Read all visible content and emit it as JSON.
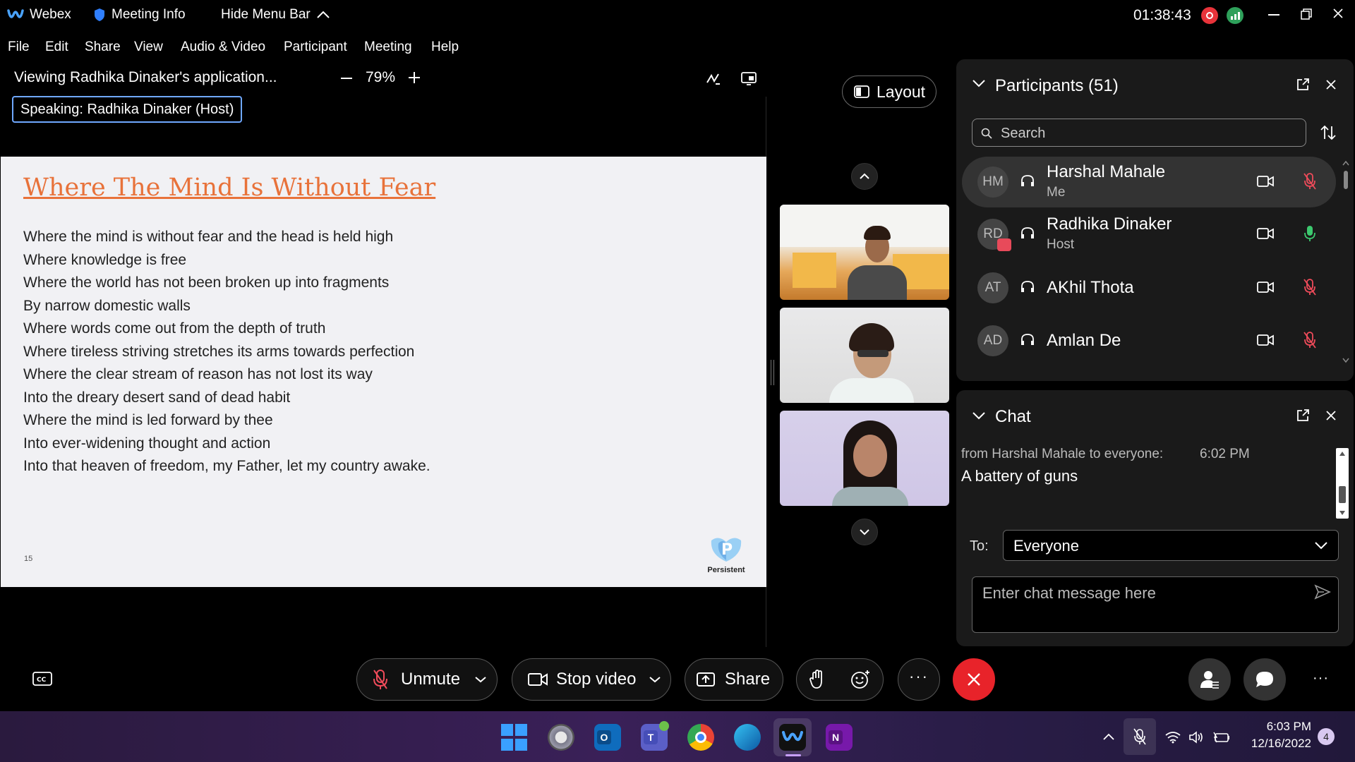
{
  "topbar": {
    "app_name": "Webex",
    "meeting_info": "Meeting Info",
    "hide_menu": "Hide Menu Bar",
    "timer": "01:38:43"
  },
  "menu": [
    "File",
    "Edit",
    "Share",
    "View",
    "Audio & Video",
    "Participant",
    "Meeting",
    "Help"
  ],
  "viewer": {
    "title": "Viewing Radhika Dinaker's application...",
    "zoom": "79%",
    "speaking_label": "Speaking:",
    "speaking_name": "Radhika Dinaker (Host)",
    "layout_label": "Layout"
  },
  "slide": {
    "title": "Where The Mind Is Without Fear",
    "lines": [
      "Where the mind is without fear and the head is held high",
      "Where knowledge is free",
      "Where the world has not been broken up into fragments",
      "By narrow domestic walls",
      "Where words come out from the depth of truth",
      "Where tireless striving stretches its arms towards perfection",
      "Where the clear stream of reason has not lost its way",
      "Into the dreary desert sand of dead habit",
      "Where the mind is led forward by thee",
      "Into ever-widening thought and action",
      "Into that heaven of freedom, my Father, let my country awake."
    ],
    "page_number": "15",
    "logo_text": "Persistent"
  },
  "participants": {
    "title": "Participants (51)",
    "search_placeholder": "Search",
    "list": [
      {
        "initials": "HM",
        "name": "Harshal Mahale",
        "role": "Me"
      },
      {
        "initials": "RD",
        "name": "Radhika Dinaker",
        "role": "Host"
      },
      {
        "initials": "AT",
        "name": "AKhil Thota",
        "role": ""
      },
      {
        "initials": "AD",
        "name": "Amlan De",
        "role": ""
      }
    ]
  },
  "chat": {
    "title": "Chat",
    "message_from": "from Harshal Mahale to everyone:",
    "message_time": "6:02 PM",
    "message_text": "A battery of guns",
    "to_label": "To:",
    "to_value": "Everyone",
    "input_placeholder": "Enter chat message here"
  },
  "toolbar": {
    "unmute": "Unmute",
    "stop_video": "Stop video",
    "share": "Share"
  },
  "taskbar": {
    "time": "6:03 PM",
    "date": "12/16/2022",
    "notification_count": "4"
  },
  "colors": {
    "slide_title": "#e8723a",
    "end_call": "#e8232a",
    "speaking_border": "#6fa8ff"
  }
}
